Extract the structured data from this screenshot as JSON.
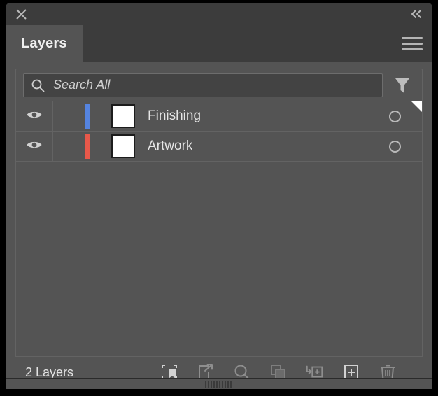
{
  "window": {
    "close_label": "×",
    "collapse_label": "«",
    "close_icon": "close-icon",
    "collapse_icon": "double-chevron-left-icon"
  },
  "tabs": [
    {
      "label": "Layers",
      "active": true
    }
  ],
  "panel_menu": {
    "icon": "hamburger-menu-icon"
  },
  "search": {
    "placeholder": "Search All",
    "value": "",
    "icon": "search-icon",
    "filter_icon": "filter-funnel-icon"
  },
  "layers": [
    {
      "name": "Finishing",
      "color": "#5584e0",
      "visible": true,
      "locked": false,
      "selected": true,
      "thumbnail_color": "#ffffff",
      "eye_icon": "eye-visible-icon",
      "target_icon": "target-circle-icon"
    },
    {
      "name": "Artwork",
      "color": "#e8584a",
      "visible": true,
      "locked": false,
      "selected": false,
      "thumbnail_color": "#ffffff",
      "eye_icon": "eye-visible-icon",
      "target_icon": "target-circle-icon"
    }
  ],
  "footer": {
    "count_label": "2 Layers",
    "tools": [
      {
        "name": "locate-object-icon",
        "label": "Locate Object",
        "enabled": true
      },
      {
        "name": "release-to-layers-icon",
        "label": "Release to Layers",
        "enabled": false
      },
      {
        "name": "collect-for-export-icon",
        "label": "Collect for Export",
        "enabled": false
      },
      {
        "name": "make-clipping-mask-icon",
        "label": "Make/Release Clipping Mask",
        "enabled": false
      },
      {
        "name": "create-new-sublayer-icon",
        "label": "Create New Sublayer",
        "enabled": false
      },
      {
        "name": "create-new-layer-icon",
        "label": "Create New Layer",
        "enabled": true
      },
      {
        "name": "delete-selection-icon",
        "label": "Delete Selection",
        "enabled": false
      }
    ]
  },
  "resize": {
    "grip_icon": "resize-grip-icon"
  },
  "colors": {
    "panel_bg": "#545454",
    "header_bg": "#3c3c3c",
    "input_bg": "#434343",
    "divider": "#636363",
    "text": "#e6e6e6"
  }
}
